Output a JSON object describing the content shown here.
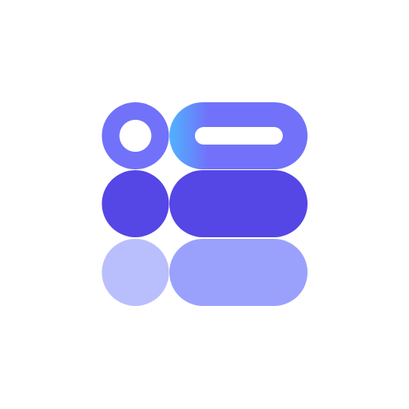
{
  "logo": {
    "icon_name": "stacked-list-app-icon",
    "colors": {
      "background": "#FFFFFF",
      "top_ring": "#7172F9",
      "top_pill": "#7172F9",
      "top_pill_gradient_start": "#4FB2FF",
      "top_pill_inner_slot": "#FFFFFF",
      "middle": "#5546E6",
      "bottom_circle": "#B9BEFD",
      "bottom_pill": "#9AA1FC"
    }
  }
}
